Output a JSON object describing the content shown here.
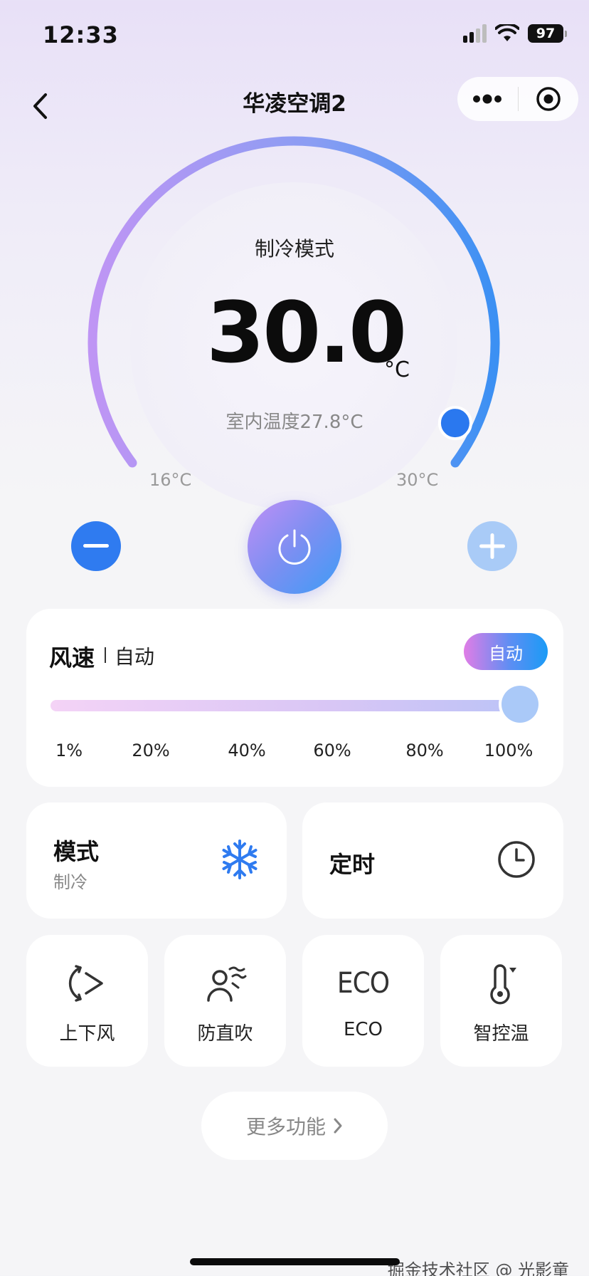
{
  "status_bar": {
    "time": "12:33",
    "battery": "97"
  },
  "nav": {
    "title": "华凌空调2"
  },
  "dial": {
    "mode_label": "制冷模式",
    "set_temp": "30.0",
    "unit": "°C",
    "indoor_temp": "室内温度27.8°C",
    "min_label": "16°C",
    "max_label": "30°C",
    "min": 16,
    "max": 30,
    "value": 30
  },
  "fan": {
    "title": "风速",
    "value": "自动",
    "auto_button": "自动",
    "level_percent": 100,
    "ticks": [
      "1%",
      "20%",
      "40%",
      "60%",
      "80%",
      "100%"
    ]
  },
  "mode_card": {
    "title": "模式",
    "value": "制冷",
    "icon": "snowflake-icon"
  },
  "timer_card": {
    "title": "定时",
    "icon": "clock-icon"
  },
  "functions": [
    {
      "label": "上下风",
      "icon": "swing-icon"
    },
    {
      "label": "防直吹",
      "icon": "anti-direct-icon"
    },
    {
      "label": "ECO",
      "icon": "eco-icon"
    },
    {
      "label": "智控温",
      "icon": "thermometer-icon"
    }
  ],
  "eco_glyph": "ECO",
  "more_button": "更多功能",
  "watermark": "掘金技术社区 @ 光影童",
  "colors": {
    "accent": "#2f7bf0",
    "accent_light": "#a9cbf7",
    "gradient_start": "#c08ff5",
    "gradient_end": "#3d9cf6"
  }
}
